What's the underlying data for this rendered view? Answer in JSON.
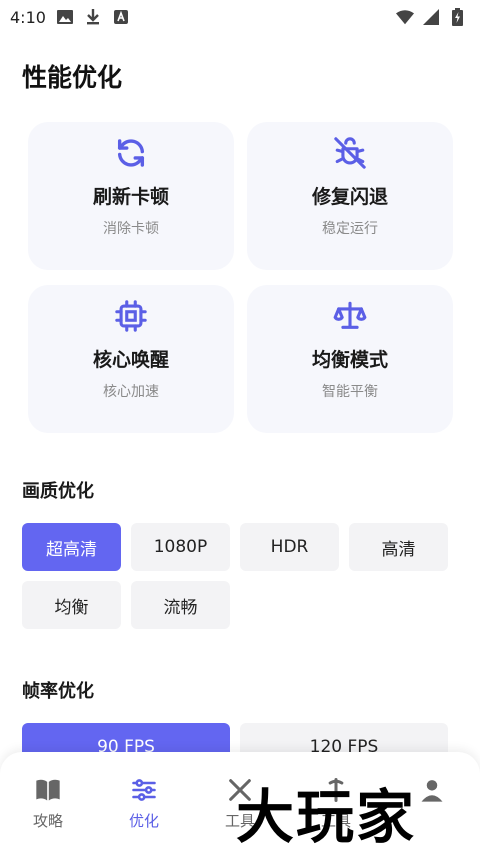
{
  "status_bar": {
    "time": "4:10"
  },
  "page": {
    "title": "性能优化"
  },
  "cards": [
    {
      "title": "刷新卡顿",
      "subtitle": "消除卡顿",
      "icon": "refresh-icon"
    },
    {
      "title": "修复闪退",
      "subtitle": "稳定运行",
      "icon": "bug-off-icon"
    },
    {
      "title": "核心唤醒",
      "subtitle": "核心加速",
      "icon": "cpu-icon"
    },
    {
      "title": "均衡模式",
      "subtitle": "智能平衡",
      "icon": "scale-icon"
    }
  ],
  "quality": {
    "title": "画质优化",
    "options": [
      "超高清",
      "1080P",
      "HDR",
      "高清",
      "均衡",
      "流畅"
    ],
    "selected": "超高清"
  },
  "framerate": {
    "title": "帧率优化",
    "options": [
      "90 FPS",
      "120 FPS"
    ],
    "selected": "90 FPS"
  },
  "nav": {
    "items": [
      {
        "label": "攻略",
        "icon": "book-icon"
      },
      {
        "label": "优化",
        "icon": "sliders-icon"
      },
      {
        "label": "工具",
        "icon": "tools-icon"
      },
      {
        "label": "工具",
        "icon": "tools-icon"
      },
      {
        "label": "",
        "icon": "profile-icon"
      }
    ],
    "active": "优化"
  },
  "watermark": {
    "text": "大玩家"
  },
  "colors": {
    "accent": "#6366f1",
    "card_bg": "#f6f7fc",
    "chip_bg": "#f3f3f5"
  }
}
